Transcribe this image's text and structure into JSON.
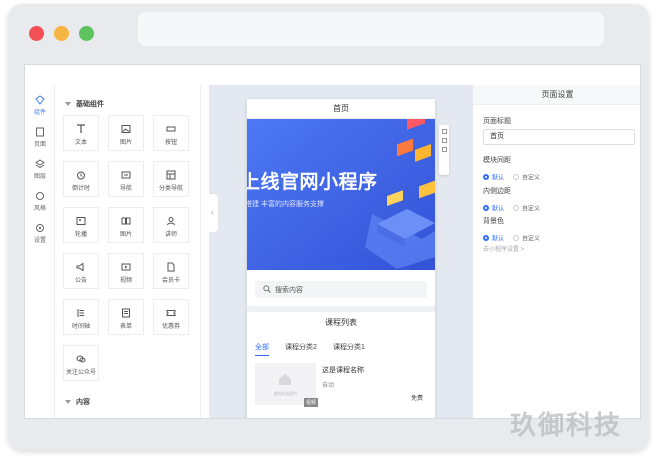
{
  "rail": {
    "items": [
      {
        "label": "组件",
        "active": true
      },
      {
        "label": "页面"
      },
      {
        "label": "图层"
      },
      {
        "label": "风格"
      },
      {
        "label": "设置"
      }
    ]
  },
  "components": {
    "group_title": "基础组件",
    "items": [
      {
        "label": "文本",
        "icon": "text-icon"
      },
      {
        "label": "图片",
        "icon": "image-icon"
      },
      {
        "label": "按钮",
        "icon": "button-icon"
      },
      {
        "label": "倒计时",
        "icon": "timer-icon"
      },
      {
        "label": "导航",
        "icon": "nav-icon"
      },
      {
        "label": "分类导航",
        "icon": "category-nav-icon"
      },
      {
        "label": "轮播",
        "icon": "carousel-icon"
      },
      {
        "label": "图片",
        "icon": "picture-icon"
      },
      {
        "label": "讲师",
        "icon": "teacher-icon"
      },
      {
        "label": "公告",
        "icon": "notice-icon"
      },
      {
        "label": "视频",
        "icon": "video-icon"
      },
      {
        "label": "会员卡",
        "icon": "member-card-icon"
      },
      {
        "label": "时间轴",
        "icon": "timeline-icon"
      },
      {
        "label": "表单",
        "icon": "form-icon"
      },
      {
        "label": "优惠券",
        "icon": "coupon-icon"
      },
      {
        "label": "关注公众号",
        "icon": "follow-icon"
      }
    ],
    "group2_title": "内容"
  },
  "phone": {
    "title": "首页",
    "banner_title": "上线官网小程序",
    "banner_sub": "搭建 丰富的内容服务支撑",
    "search_placeholder": "搜索内容",
    "section_title": "课程列表",
    "tabs": [
      "全部",
      "课程分类2",
      "课程分类1"
    ],
    "course": {
      "name": "这是课程名称",
      "category": "自动",
      "price": "免费",
      "badge": "视频",
      "thumb_label": "课程封面图片"
    }
  },
  "props": {
    "header": "页面设置",
    "page_title_label": "页面标题",
    "page_title_value": "首页",
    "module_spacing_label": "模块间距",
    "content_padding_label": "内侧边距",
    "bg_color_label": "背景色",
    "opt_default": "默认",
    "opt_custom": "自定义",
    "link": "去小程序设置 >"
  },
  "watermark": "玖御科技",
  "colors": {
    "accent": "#2f6df6",
    "banner": "#3f63e8"
  }
}
